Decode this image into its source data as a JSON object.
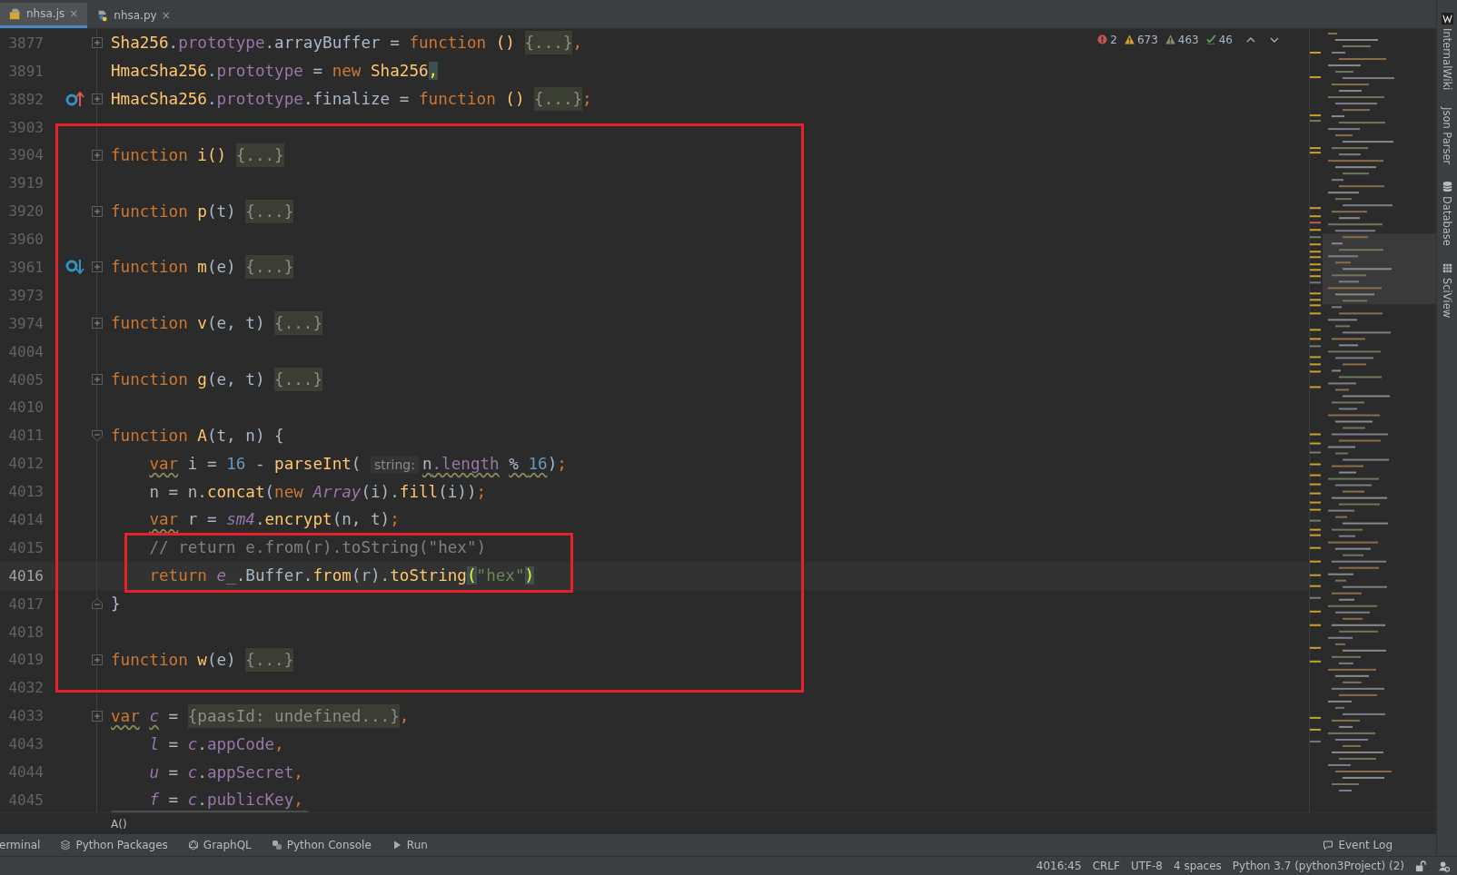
{
  "tabs": [
    {
      "label": "nhsa.js",
      "kind": "js",
      "close": "×",
      "selected": true
    },
    {
      "label": "nhsa.py",
      "kind": "py",
      "close": "×",
      "selected": false
    }
  ],
  "inspections": [
    {
      "kind": "error",
      "count": "2"
    },
    {
      "kind": "warning",
      "count": "673"
    },
    {
      "kind": "weak",
      "count": "463"
    },
    {
      "kind": "typo",
      "count": "46"
    }
  ],
  "editor": {
    "lines": [
      {
        "number": "3877",
        "kind": "collapsed",
        "current": false,
        "tokens": [
          {
            "t": "Sha256",
            "kind": "fn"
          },
          {
            "t": ".",
            "kind": "plain"
          },
          {
            "t": "prototype",
            "kind": "prop"
          },
          {
            "t": ".arrayBuffer = ",
            "kind": "plain"
          },
          {
            "t": "function",
            "kind": "kw"
          },
          {
            "t": " () ",
            "kind": "fn"
          },
          {
            "t": "{...}",
            "kind": "fold"
          },
          {
            "t": ",",
            "kind": "punct"
          }
        ]
      },
      {
        "number": "3891",
        "kind": "plain",
        "current": false,
        "tokens": [
          {
            "t": "HmacSha256",
            "kind": "fn"
          },
          {
            "t": ".",
            "kind": "plain"
          },
          {
            "t": "prototype",
            "kind": "prop"
          },
          {
            "t": " = ",
            "kind": "plain"
          },
          {
            "t": "new ",
            "kind": "kw"
          },
          {
            "t": "Sha256",
            "kind": "fn"
          },
          {
            "t": ",",
            "kind": "match"
          }
        ]
      },
      {
        "number": "3892",
        "kind": "collapsed",
        "gutter": [
          {
            "kind": "up"
          }
        ],
        "current": false,
        "tokens": [
          {
            "t": "HmacSha256",
            "kind": "fn"
          },
          {
            "t": ".",
            "kind": "plain"
          },
          {
            "t": "prototype",
            "kind": "prop"
          },
          {
            "t": ".finalize = ",
            "kind": "plain"
          },
          {
            "t": "function",
            "kind": "kw"
          },
          {
            "t": " () ",
            "kind": "fn"
          },
          {
            "t": "{...}",
            "kind": "fold"
          },
          {
            "t": ";",
            "kind": "punct"
          }
        ]
      },
      {
        "number": "3903",
        "kind": "plain",
        "current": false
      },
      {
        "number": "3904",
        "kind": "collapsed",
        "current": false,
        "tokens": [
          {
            "t": "function ",
            "kind": "kw"
          },
          {
            "t": "i() ",
            "kind": "fn"
          },
          {
            "t": "{...}",
            "kind": "fold"
          }
        ]
      },
      {
        "number": "3919",
        "kind": "plain",
        "current": false
      },
      {
        "number": "3920",
        "kind": "collapsed",
        "current": false,
        "tokens": [
          {
            "t": "function ",
            "kind": "kw"
          },
          {
            "t": "p",
            "kind": "fn"
          },
          {
            "t": "(t) ",
            "kind": "plain"
          },
          {
            "t": "{...}",
            "kind": "fold"
          }
        ]
      },
      {
        "number": "3960",
        "kind": "plain",
        "current": false
      },
      {
        "number": "3961",
        "kind": "collapsed",
        "gutter": [
          {
            "kind": "down"
          }
        ],
        "current": false,
        "tokens": [
          {
            "t": "function ",
            "kind": "kw"
          },
          {
            "t": "m",
            "kind": "fn"
          },
          {
            "t": "(e) ",
            "kind": "plain"
          },
          {
            "t": "{...}",
            "kind": "fold"
          }
        ]
      },
      {
        "number": "3973",
        "kind": "plain",
        "current": false
      },
      {
        "number": "3974",
        "kind": "collapsed",
        "current": false,
        "tokens": [
          {
            "t": "function ",
            "kind": "kw"
          },
          {
            "t": "v",
            "kind": "fn"
          },
          {
            "t": "(e, t) ",
            "kind": "plain"
          },
          {
            "t": "{...}",
            "kind": "fold"
          }
        ]
      },
      {
        "number": "4004",
        "kind": "plain",
        "current": false
      },
      {
        "number": "4005",
        "kind": "collapsed",
        "current": false,
        "tokens": [
          {
            "t": "function ",
            "kind": "kw"
          },
          {
            "t": "g",
            "kind": "fn"
          },
          {
            "t": "(e, t) ",
            "kind": "plain"
          },
          {
            "t": "{...}",
            "kind": "fold"
          }
        ]
      },
      {
        "number": "4010",
        "kind": "plain",
        "current": false
      },
      {
        "number": "4011",
        "kind": "expanded",
        "current": false,
        "tokens": [
          {
            "t": "function ",
            "kind": "kw"
          },
          {
            "t": "A",
            "kind": "fn"
          },
          {
            "t": "(t, n) {",
            "kind": "plain"
          }
        ]
      },
      {
        "number": "4012",
        "kind": "plain",
        "current": false,
        "tokens": [
          {
            "t": "    var",
            "kind": "kw_warn"
          },
          {
            "t": " i = ",
            "kind": "plain"
          },
          {
            "t": "16",
            "kind": "num"
          },
          {
            "t": " - ",
            "kind": "plain"
          },
          {
            "t": "parseInt",
            "kind": "fn"
          },
          {
            "t": "( ",
            "kind": "plain"
          },
          {
            "t": "string:",
            "kind": "hint"
          },
          {
            "t": "n",
            "kind": "plain_warn"
          },
          {
            "t": ".length",
            "kind": "prop_warn"
          },
          {
            "t": " % ",
            "kind": "plain_warn"
          },
          {
            "t": "16",
            "kind": "num_warn"
          },
          {
            "t": ")",
            "kind": "plain"
          },
          {
            "t": ";",
            "kind": "punct"
          }
        ]
      },
      {
        "number": "4013",
        "kind": "plain",
        "current": false,
        "tokens": [
          {
            "t": "    n = n.",
            "kind": "plain"
          },
          {
            "t": "concat",
            "kind": "fn"
          },
          {
            "t": "(",
            "kind": "plain"
          },
          {
            "t": "new ",
            "kind": "kw"
          },
          {
            "t": "Array",
            "kind": "ital"
          },
          {
            "t": "(i).",
            "kind": "plain"
          },
          {
            "t": "fill",
            "kind": "fn"
          },
          {
            "t": "(i))",
            "kind": "plain"
          },
          {
            "t": ";",
            "kind": "punct"
          }
        ]
      },
      {
        "number": "4014",
        "kind": "plain",
        "current": false,
        "tokens": [
          {
            "t": "    var",
            "kind": "kw_warn"
          },
          {
            "t": " r = ",
            "kind": "plain"
          },
          {
            "t": "sm4",
            "kind": "ital"
          },
          {
            "t": ".",
            "kind": "plain"
          },
          {
            "t": "encrypt",
            "kind": "fn"
          },
          {
            "t": "(n, t)",
            "kind": "plain"
          },
          {
            "t": ";",
            "kind": "punct"
          }
        ]
      },
      {
        "number": "4015",
        "kind": "plain",
        "current": false,
        "tokens": [
          {
            "t": "    // return e.from(r).toString(\"hex\")",
            "kind": "com"
          }
        ]
      },
      {
        "number": "4016",
        "kind": "plain",
        "current": true,
        "tokens": [
          {
            "t": "    return ",
            "kind": "kw"
          },
          {
            "t": "e_",
            "kind": "ital"
          },
          {
            "t": ".Buffer.",
            "kind": "plain"
          },
          {
            "t": "from",
            "kind": "fn"
          },
          {
            "t": "(r).",
            "kind": "plain"
          },
          {
            "t": "toString",
            "kind": "fn"
          },
          {
            "t": "(",
            "kind": "match"
          },
          {
            "t": "\"hex\"",
            "kind": "str"
          },
          {
            "t": ")",
            "kind": "match"
          }
        ]
      },
      {
        "number": "4017",
        "kind": "end",
        "current": false,
        "tokens": [
          {
            "t": "}",
            "kind": "plain"
          }
        ]
      },
      {
        "number": "4018",
        "kind": "plain",
        "current": false
      },
      {
        "number": "4019",
        "kind": "collapsed",
        "current": false,
        "tokens": [
          {
            "t": "function ",
            "kind": "kw"
          },
          {
            "t": "w",
            "kind": "fn"
          },
          {
            "t": "(e) ",
            "kind": "plain"
          },
          {
            "t": "{...}",
            "kind": "fold"
          }
        ]
      },
      {
        "number": "4032",
        "kind": "plain",
        "current": false
      },
      {
        "number": "4033",
        "kind": "collapsed",
        "current": false,
        "tokens": [
          {
            "t": "var",
            "kind": "kw_warn"
          },
          {
            "t": " c",
            "kind": "ital_warn"
          },
          {
            "t": " = ",
            "kind": "plain"
          },
          {
            "t": "{paasId: undefined...}",
            "kind": "fold"
          },
          {
            "t": ",",
            "kind": "punct"
          }
        ]
      },
      {
        "number": "4043",
        "kind": "plain",
        "current": false,
        "tokens": [
          {
            "t": "    l",
            "kind": "ital"
          },
          {
            "t": " = ",
            "kind": "plain"
          },
          {
            "t": "c",
            "kind": "ital"
          },
          {
            "t": ".",
            "kind": "plain"
          },
          {
            "t": "appCode",
            "kind": "prop"
          },
          {
            "t": ",",
            "kind": "punct"
          }
        ]
      },
      {
        "number": "4044",
        "kind": "plain",
        "current": false,
        "tokens": [
          {
            "t": "    u",
            "kind": "ital"
          },
          {
            "t": " = ",
            "kind": "plain"
          },
          {
            "t": "c",
            "kind": "ital"
          },
          {
            "t": ".",
            "kind": "plain"
          },
          {
            "t": "appSecret",
            "kind": "prop"
          },
          {
            "t": ",",
            "kind": "punct"
          }
        ]
      },
      {
        "number": "4045",
        "kind": "plain",
        "current": false,
        "tokens": [
          {
            "t": "    f",
            "kind": "ital"
          },
          {
            "t": " = ",
            "kind": "plain"
          },
          {
            "t": "c",
            "kind": "ital"
          },
          {
            "t": ".",
            "kind": "plain"
          },
          {
            "t": "publicKey",
            "kind": "prop"
          },
          {
            "t": ",",
            "kind": "punct"
          }
        ]
      }
    ]
  },
  "right_strip": [
    {
      "label": "InternalWiki",
      "kind": "wiki"
    },
    {
      "label": "Json Parser",
      "kind": "plain"
    },
    {
      "label": "Database",
      "kind": "database"
    },
    {
      "label": "SciView",
      "kind": "grid"
    }
  ],
  "breadcrumb": "A()",
  "tool_windows": [
    {
      "label": "erminal",
      "kind": "plain"
    },
    {
      "label": "Python Packages",
      "kind": "packages"
    },
    {
      "label": "GraphQL",
      "kind": "graphql"
    },
    {
      "label": "Python Console",
      "kind": "python"
    },
    {
      "label": "Run",
      "kind": "run"
    }
  ],
  "event_log": "Event Log",
  "status_bar": [
    "4016:45",
    "CRLF",
    "UTF-8",
    "4 spaces",
    "Python 3.7 (python3Project) (2)"
  ]
}
